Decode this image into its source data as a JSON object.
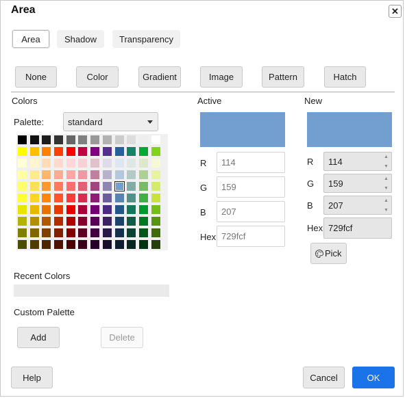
{
  "title": "Area",
  "tabs": [
    {
      "label": "Area",
      "selected": true
    },
    {
      "label": "Shadow",
      "selected": false
    },
    {
      "label": "Transparency",
      "selected": false
    }
  ],
  "fill_buttons": [
    "None",
    "Color",
    "Gradient",
    "Image",
    "Pattern",
    "Hatch"
  ],
  "colors_heading": "Colors",
  "palette": {
    "label": "Palette:",
    "value": "standard"
  },
  "color_rows": [
    [
      "#000000",
      "#111111",
      "#1c1c1c",
      "#333333",
      "#666666",
      "#808080",
      "#999999",
      "#b2b2b2",
      "#cccccc",
      "#dddddd",
      "#eeeeee",
      "#ffffff"
    ],
    [
      "#ffff00",
      "#ffbf00",
      "#ff8000",
      "#ff4000",
      "#ff0000",
      "#bf0041",
      "#800080",
      "#55308d",
      "#2a6099",
      "#158466",
      "#00a933",
      "#81d41a"
    ],
    [
      "#ffffd7",
      "#fff5ce",
      "#ffdbb6",
      "#ffd8ce",
      "#ffd7d7",
      "#f7d1d5",
      "#e0c2cd",
      "#dedce6",
      "#dee6ef",
      "#dee7e5",
      "#dde8cb",
      "#f6f9d4"
    ],
    [
      "#ffffa6",
      "#ffe994",
      "#ffb66c",
      "#ffaa95",
      "#ffa6a6",
      "#ec9ba4",
      "#bf819e",
      "#b7b3ca",
      "#b4c7dc",
      "#b3cac7",
      "#afd095",
      "#e8f2a1"
    ],
    [
      "#ffff6d",
      "#ffde59",
      "#ff972f",
      "#ff7b59",
      "#ff6d6d",
      "#e16173",
      "#a1467e",
      "#8e86ae",
      "#729fcf",
      "#81aca6",
      "#77bc65",
      "#d4ea6b"
    ],
    [
      "#ffff38",
      "#ffd428",
      "#ff860d",
      "#ff5429",
      "#ff3838",
      "#d62e4e",
      "#8d1d75",
      "#6b5e9b",
      "#5983b0",
      "#50938a",
      "#3faf46",
      "#c9e23e"
    ],
    [
      "#e6e600",
      "#e6b800",
      "#e67300",
      "#e63900",
      "#e60000",
      "#a9003a",
      "#730073",
      "#4c2b80",
      "#255688",
      "#13775c",
      "#00992e",
      "#73bf17"
    ],
    [
      "#b2b200",
      "#b28f00",
      "#b25900",
      "#b22c00",
      "#b20000",
      "#83002d",
      "#590059",
      "#3b2263",
      "#1d436a",
      "#0f5c47",
      "#007723",
      "#599412"
    ],
    [
      "#808000",
      "#806600",
      "#804000",
      "#802000",
      "#800000",
      "#5e0021",
      "#400040",
      "#2a1847",
      "#15304c",
      "#0b4233",
      "#005519",
      "#3f6a0d"
    ],
    [
      "#4d4d00",
      "#4d3d00",
      "#4d2600",
      "#4d1300",
      "#4d0000",
      "#38001a",
      "#260026",
      "#190e2a",
      "#0d1d2d",
      "#062820",
      "#00330f",
      "#263f08"
    ]
  ],
  "selected_color": "#729fcf",
  "recent_colors_label": "Recent Colors",
  "custom_palette": {
    "label": "Custom Palette",
    "add": "Add",
    "delete": "Delete"
  },
  "active": {
    "label": "Active",
    "color": "#729fcf",
    "r_label": "R",
    "r": "114",
    "g_label": "G",
    "g": "159",
    "b_label": "B",
    "b": "207",
    "hex_label": "Hex",
    "hex": "729fcf"
  },
  "new": {
    "label": "New",
    "color": "#729fcf",
    "r_label": "R",
    "r": "114",
    "g_label": "G",
    "g": "159",
    "b_label": "B",
    "b": "207",
    "hex_label": "Hex",
    "hex": "729fcf",
    "pick": "Pick"
  },
  "footer": {
    "help": "Help",
    "cancel": "Cancel",
    "ok": "OK"
  },
  "colors": {
    "accent": "#1a73e8"
  }
}
